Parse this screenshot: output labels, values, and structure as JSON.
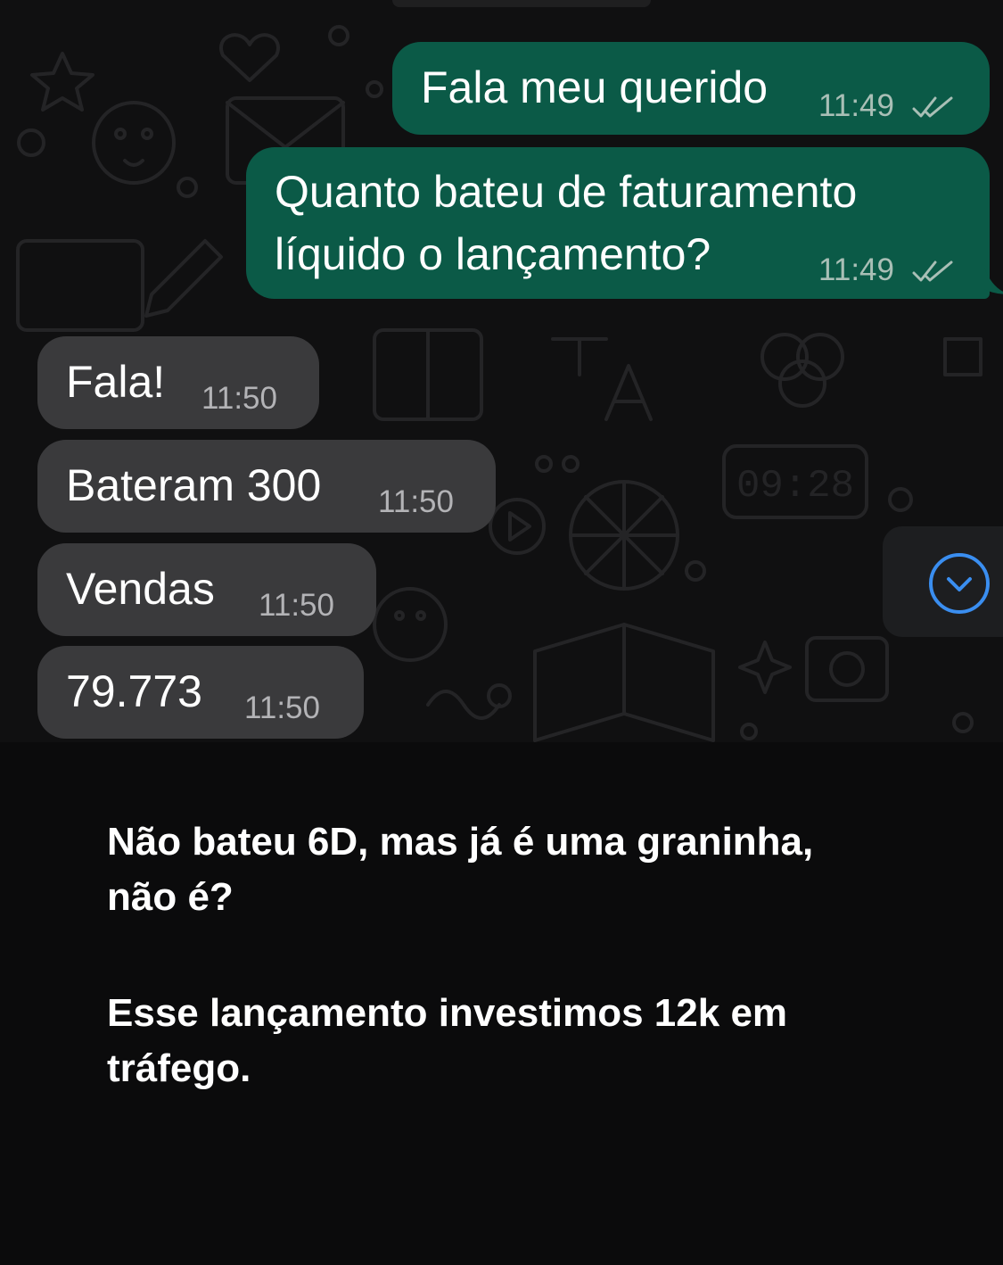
{
  "messages": [
    {
      "direction": "outgoing",
      "text": "Fala meu querido",
      "time": "11:49",
      "status_icon": "double-check-icon"
    },
    {
      "direction": "outgoing",
      "text": "Quanto bateu de faturamento\nlíquido o lançamento?",
      "time": "11:49",
      "status_icon": "double-check-icon"
    },
    {
      "direction": "incoming",
      "text": "Fala!",
      "time": "11:50"
    },
    {
      "direction": "incoming",
      "text": "Bateram 300",
      "time": "11:50"
    },
    {
      "direction": "incoming",
      "text": "Vendas",
      "time": "11:50"
    },
    {
      "direction": "incoming",
      "text": "79.773",
      "time": "11:50"
    }
  ],
  "scroll_button": {
    "icon": "chevron-down-circle-icon"
  },
  "caption": {
    "paragraph1": "Não bateu 6D, mas já é uma graninha,\nnão é?",
    "paragraph2": "Esse lançamento investimos 12k em\ntráfego."
  },
  "colors": {
    "outgoing_bubble": "#0b5a47",
    "incoming_bubble": "#3a3a3c",
    "accent_blue": "#3a8ef0",
    "background": "#0b0b0c"
  },
  "wallpaper_clock_text": "09:28"
}
